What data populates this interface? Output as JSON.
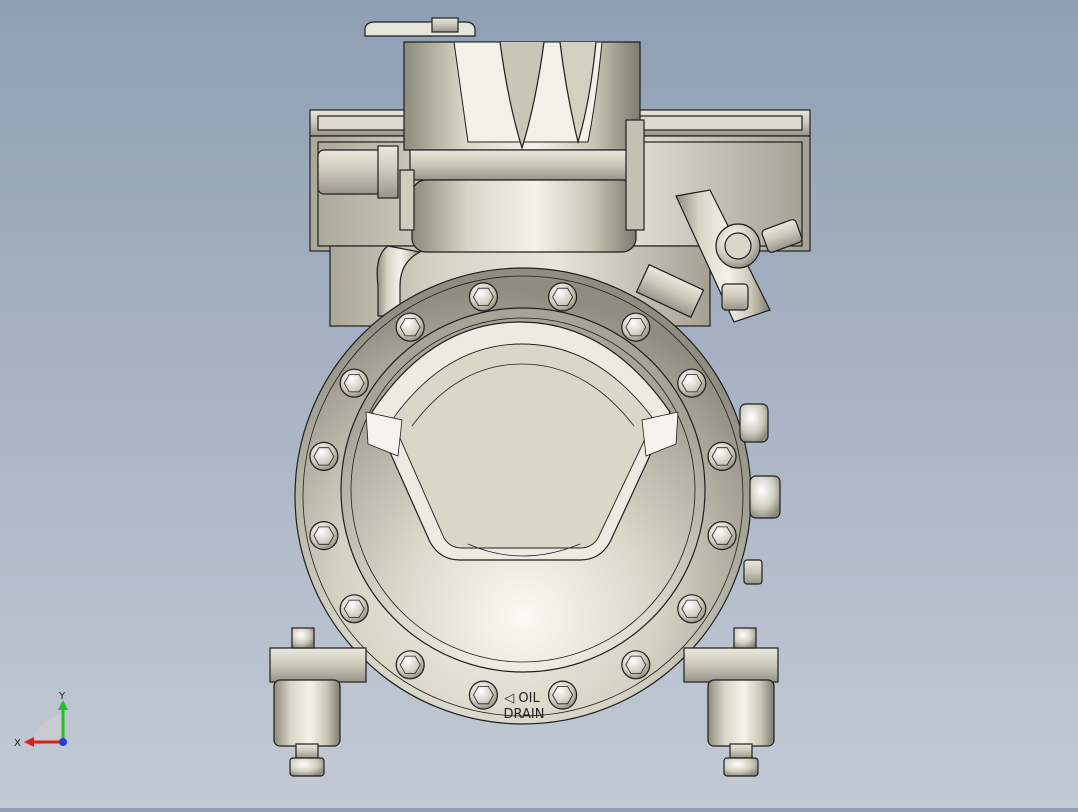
{
  "viewport": {
    "background_top": "#8f9fb4",
    "background_bottom": "#c3cad5"
  },
  "model": {
    "icon": "compressor-model",
    "label_oil": "◁ OIL",
    "label_drain": "DRAIN"
  },
  "triad": {
    "icon": "axis-triad-icon",
    "x_label": "X",
    "y_label": "Y",
    "x_color": "#e02020",
    "y_color": "#20c020",
    "z_color": "#2040e0"
  }
}
